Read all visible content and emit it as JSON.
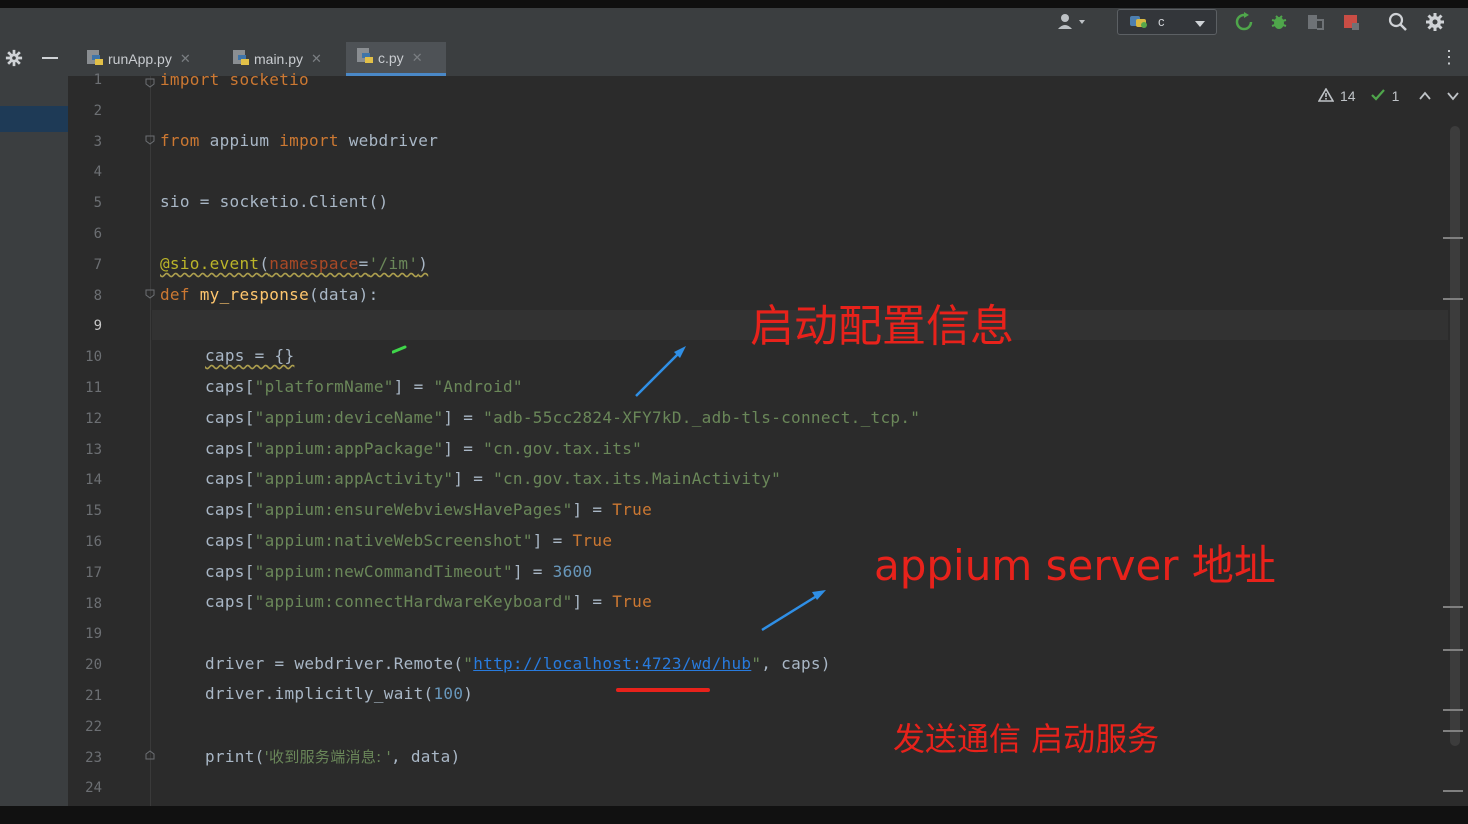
{
  "tabs": [
    {
      "label": "runApp.py",
      "active": false
    },
    {
      "label": "main.py",
      "active": false
    },
    {
      "label": "c.py",
      "active": true
    }
  ],
  "toolbar": {
    "run_config": "c",
    "icons": [
      "user-icon",
      "run-config-icon",
      "rerun-icon",
      "debug-icon",
      "attach-icon",
      "stop-icon",
      "search-icon",
      "gear-icon"
    ]
  },
  "inspection": {
    "warnings": "14",
    "ok": "1"
  },
  "lines": {
    "l1": "import socketio",
    "l3a": "from",
    "l3b": " appium ",
    "l3c": "import",
    "l3d": " webdriver",
    "l5": "sio = socketio.Client()",
    "l7a": "@sio.event",
    "l7b": "(",
    "l7c": "namespace",
    "l7d": "=",
    "l7e": "'/im'",
    "l7f": ")",
    "l8a": "def",
    "l8b": " my_response",
    "l8c": "(data):",
    "l10": "caps = {}",
    "l11a": "caps[",
    "l11b": "\"platformName\"",
    "l11c": "] = ",
    "l11d": "\"Android\"",
    "l12a": "caps[",
    "l12b": "\"appium:deviceName\"",
    "l12c": "] = ",
    "l12d": "\"adb-55cc2824-XFY7kD._adb-tls-connect._tcp.\"",
    "l13a": "caps[",
    "l13b": "\"appium:appPackage\"",
    "l13c": "] = ",
    "l13d": "\"cn.gov.tax.its\"",
    "l14a": "caps[",
    "l14b": "\"appium:appActivity\"",
    "l14c": "] = ",
    "l14d": "\"cn.gov.tax.its.MainActivity\"",
    "l15a": "caps[",
    "l15b": "\"appium:ensureWebviewsHavePages\"",
    "l15c": "] = ",
    "l15d": "True",
    "l16a": "caps[",
    "l16b": "\"appium:nativeWebScreenshot\"",
    "l16c": "] = ",
    "l16d": "True",
    "l17a": "caps[",
    "l17b": "\"appium:newCommandTimeout\"",
    "l17c": "] = ",
    "l17d": "3600",
    "l18a": "caps[",
    "l18b": "\"appium:connectHardwareKeyboard\"",
    "l18c": "] = ",
    "l18d": "True",
    "l20a": "driver = webdriver.Remote(",
    "l20b": "\"",
    "l20c": "http://localhost:4723/wd/hub",
    "l20d": "\"",
    "l20e": ", caps)",
    "l21a": "driver.implicitly_wait(",
    "l21b": "100",
    "l21c": ")",
    "l23a": "print(",
    "l23b": "'收到服务端消息: '",
    "l23c": ", data)"
  },
  "line_numbers": [
    "1",
    "2",
    "3",
    "4",
    "5",
    "6",
    "7",
    "8",
    "9",
    "10",
    "11",
    "12",
    "13",
    "14",
    "15",
    "16",
    "17",
    "18",
    "19",
    "20",
    "21",
    "22",
    "23",
    "24"
  ],
  "annotations": {
    "config": "启动配置信息",
    "server": "appium server 地址",
    "comm": "发送通信 启动服务"
  },
  "colors": {
    "annotation": "#e8221b",
    "arrow": "#2f8fe6",
    "keyword": "#cc7832",
    "string": "#6a8759",
    "number": "#6897bb"
  }
}
